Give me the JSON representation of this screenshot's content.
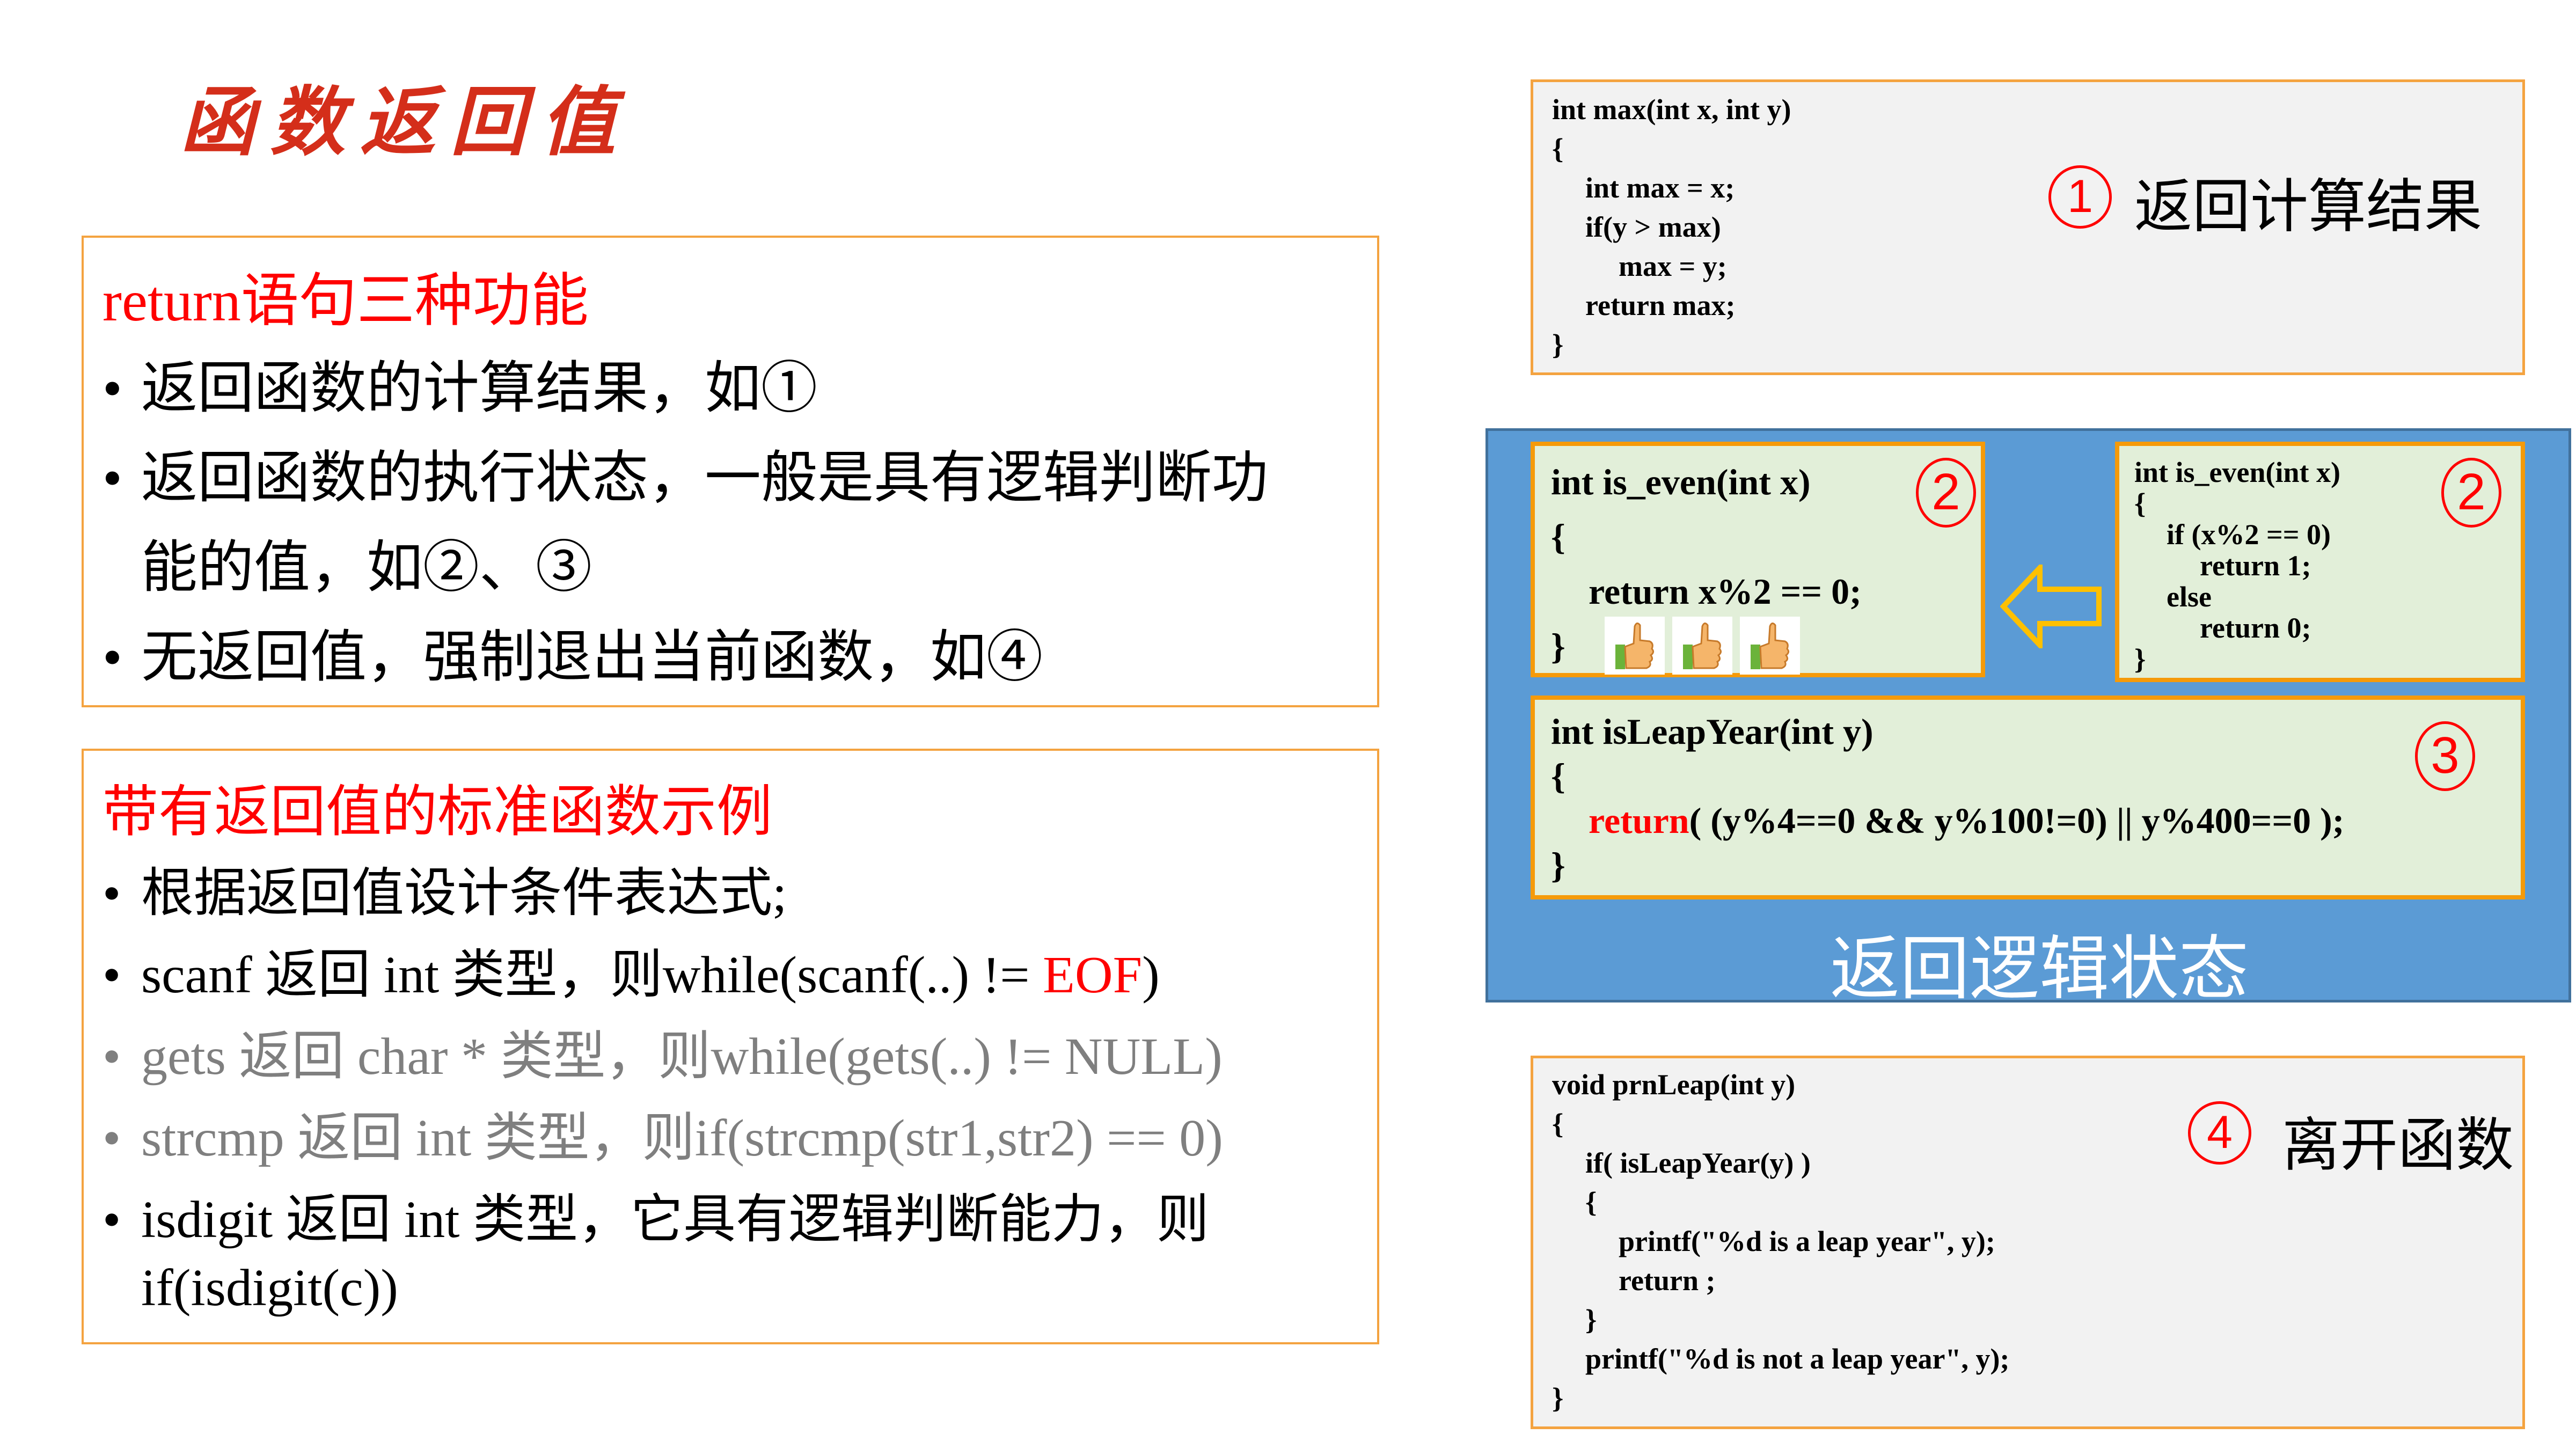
{
  "title": "函数返回值",
  "functions_box": {
    "heading": "return语句三种功能",
    "bullets": [
      "返回函数的计算结果，如①",
      "返回函数的执行状态，一般是具有逻辑判断功",
      "能的值，如②、③",
      "无返回值，强制退出当前函数，如④"
    ]
  },
  "examples_box": {
    "heading": "带有返回值的标准函数示例",
    "bullets": [
      {
        "text": "根据返回值设计条件表达式;"
      },
      {
        "text": "scanf 返回 int 类型，则while(scanf(..) != ",
        "red": "EOF",
        "tail": ")"
      },
      {
        "text": "gets 返回 char * 类型，则while(gets(..) != NULL)"
      },
      {
        "text": "strcmp 返回 int 类型，则if(strcmp(str1,str2) == 0)"
      },
      {
        "text": "isdigit 返回 int 类型，它具有逻辑判断能力，则"
      },
      {
        "text": "if(isdigit(c))"
      }
    ]
  },
  "example1": {
    "lines": [
      "int max(int x, int y)",
      "{",
      "int max = x;",
      "if(y > max)",
      "max = y;",
      "return max;",
      "}"
    ],
    "number": "1",
    "caption": "返回计算结果"
  },
  "logic_panel": {
    "label": "返回逻辑状态",
    "colors": {
      "panel": "#5b9bd5",
      "box": "#e2efd9",
      "border": "#f59a0a"
    },
    "box_a": {
      "lines": [
        "int is_even(int x)",
        "{",
        "return x%2 == 0;",
        "}"
      ],
      "number": "2",
      "icons": [
        "thumbs-up-icon",
        "thumbs-up-icon",
        "thumbs-up-icon"
      ]
    },
    "box_b": {
      "lines": [
        "int is_even(int x)",
        "{",
        "if (x%2 == 0)",
        "return 1;",
        "else",
        "return 0;",
        "}"
      ],
      "number": "2"
    },
    "box_c": {
      "lines": [
        "int isLeapYear(int y)",
        "{",
        "return",
        "( (y%4==0 && y%100!=0) || y%400==0 );",
        "}"
      ],
      "number": "3"
    }
  },
  "example4": {
    "lines": [
      "void prnLeap(int y)",
      "{",
      "if( isLeapYear(y) )",
      "{",
      "printf(\"%d is a leap year\", y);",
      "return ;",
      "}",
      "printf(\"%d is not a leap year\", y);",
      "}"
    ],
    "number": "4",
    "caption": "离开函数"
  }
}
